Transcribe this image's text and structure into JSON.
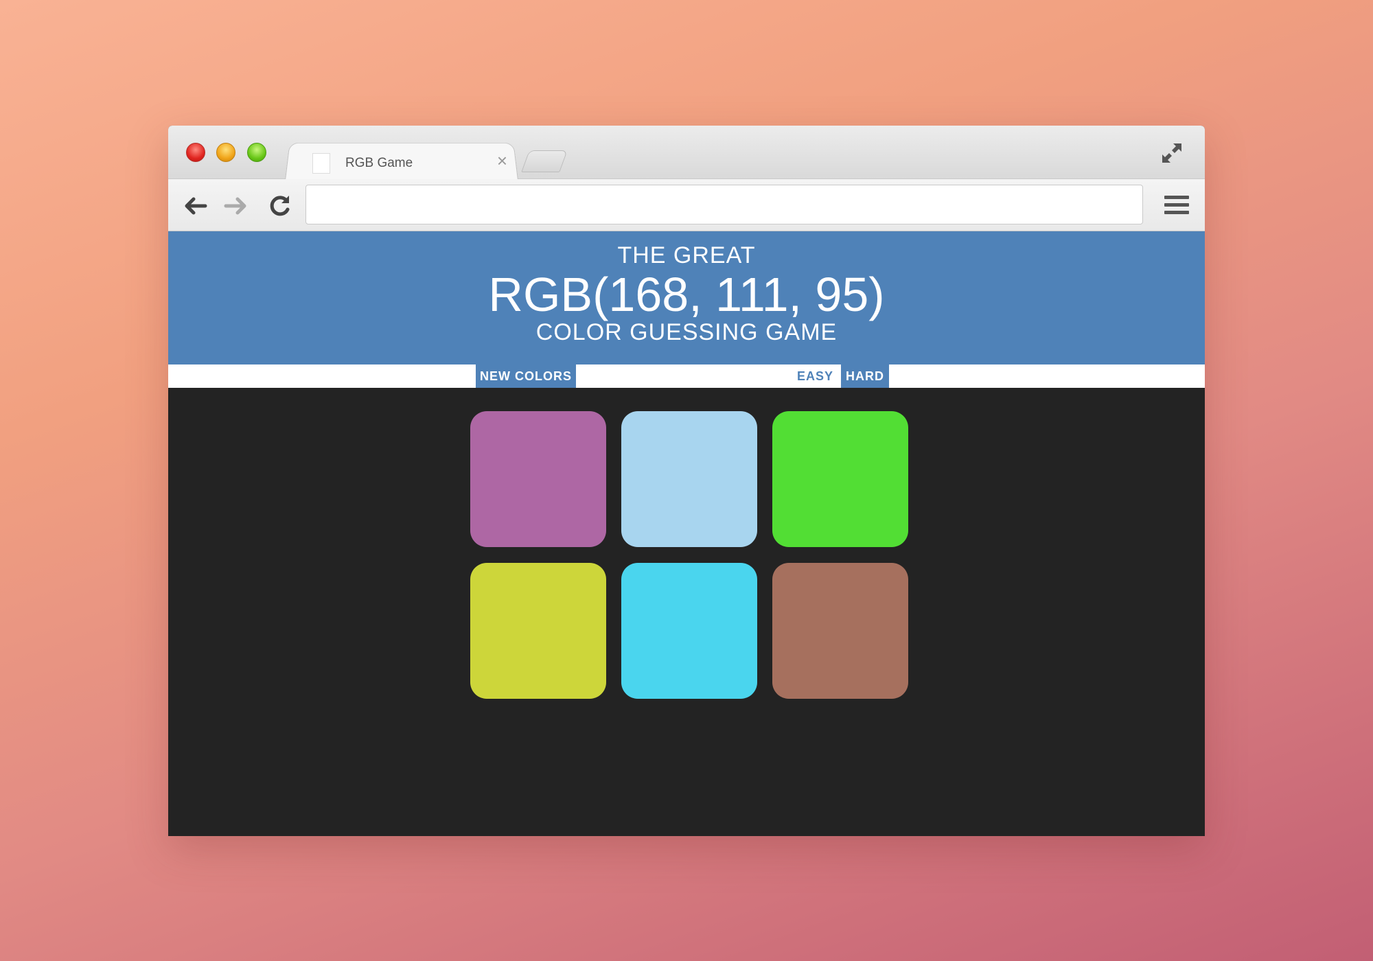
{
  "browser": {
    "tab_title": "RGB Game",
    "tab_close": "×",
    "address_value": ""
  },
  "game": {
    "title_top": "THE GREAT",
    "target_rgb": "RGB(168, 111, 95)",
    "title_bottom": "COLOR GUESSING GAME",
    "new_colors_label": "NEW COLORS",
    "easy_label": "EASY",
    "hard_label": "HARD",
    "header_color": "#4f82b8",
    "squares": [
      {
        "color": "#ae67a4"
      },
      {
        "color": "#a8d5ef"
      },
      {
        "color": "#52de34"
      },
      {
        "color": "#cdd63a"
      },
      {
        "color": "#4ad5ee"
      },
      {
        "color": "#a6705e"
      }
    ]
  },
  "icons": [
    "close-light",
    "minimize-light",
    "maximize-light",
    "favicon",
    "new-tab",
    "fullscreen-icon",
    "back-arrow-icon",
    "forward-arrow-icon",
    "reload-icon",
    "menu-icon"
  ]
}
